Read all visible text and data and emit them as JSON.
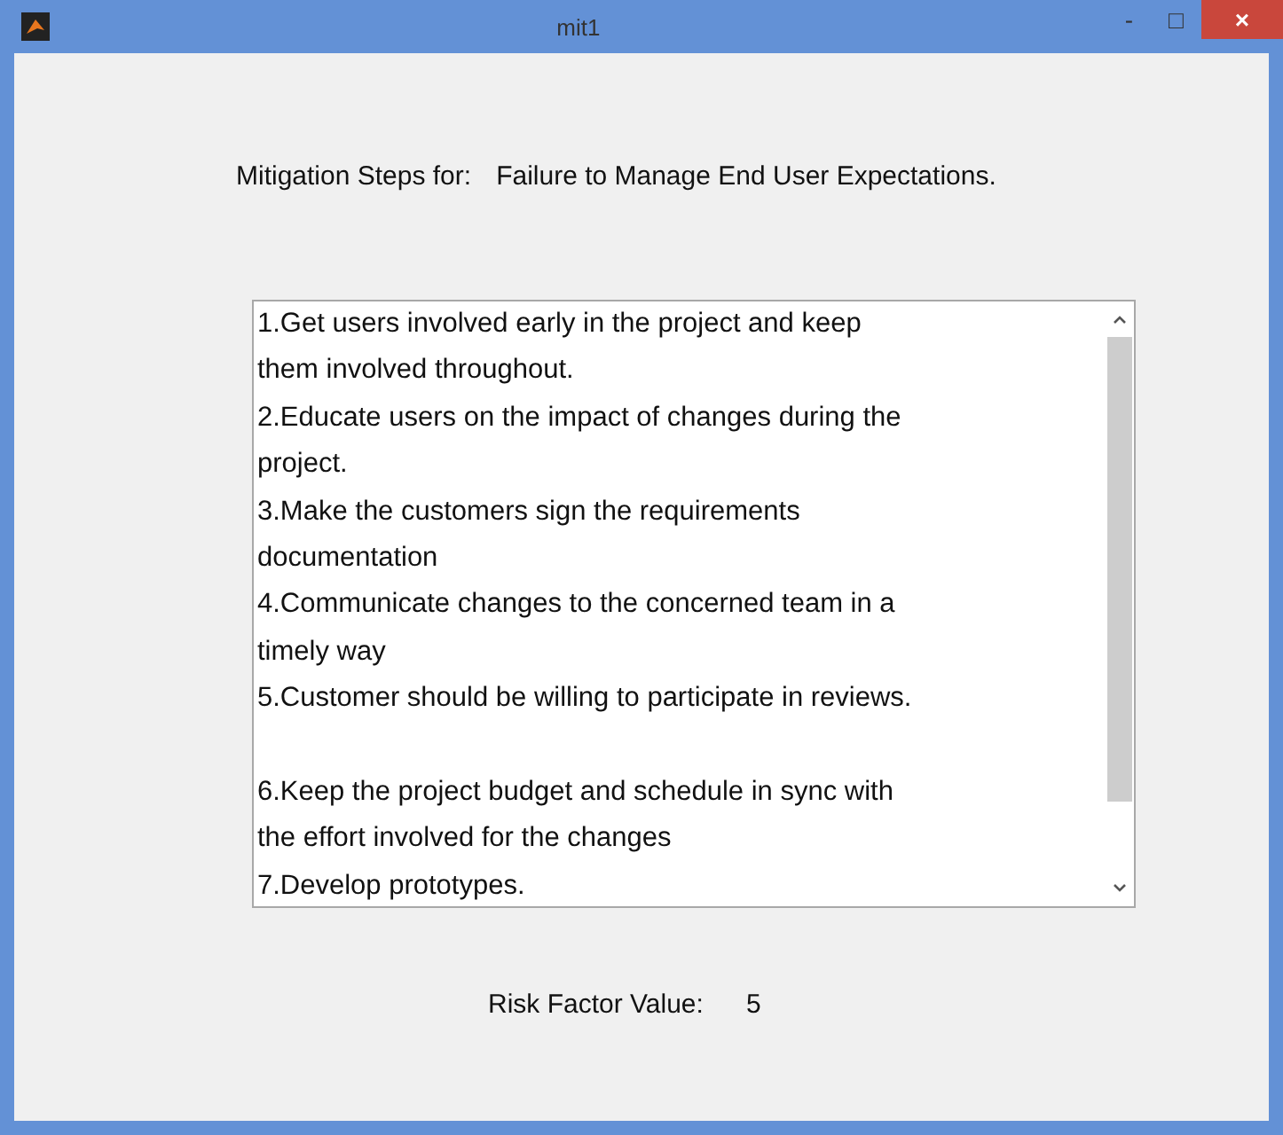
{
  "window": {
    "title": "mit1",
    "controls": [
      "-",
      "□",
      "×"
    ]
  },
  "heading": {
    "label": "Mitigation Steps for:",
    "value": "Failure to Manage End User Expectations."
  },
  "steps": [
    {
      "lines": [
        "1.Get users involved early in the project and keep",
        "them involved throughout."
      ],
      "blank_before": false
    },
    {
      "lines": [
        "2.Educate users on the impact of changes during the",
        "project."
      ],
      "blank_before": false
    },
    {
      "lines": [
        "3.Make the customers sign the requirements",
        "documentation"
      ],
      "blank_before": false
    },
    {
      "lines": [
        "4.Communicate changes to the concerned team in a",
        "timely way"
      ],
      "blank_before": false
    },
    {
      "lines": [
        "5.Customer should be willing to participate in reviews."
      ],
      "blank_before": false
    },
    {
      "lines": [
        "6.Keep the project budget and schedule in sync with",
        "the effort involved for the changes"
      ],
      "blank_before": true
    },
    {
      "lines": [
        "7.Develop prototypes."
      ],
      "blank_before": false
    }
  ],
  "risk": {
    "label": "Risk Factor Value:",
    "value": "5"
  }
}
